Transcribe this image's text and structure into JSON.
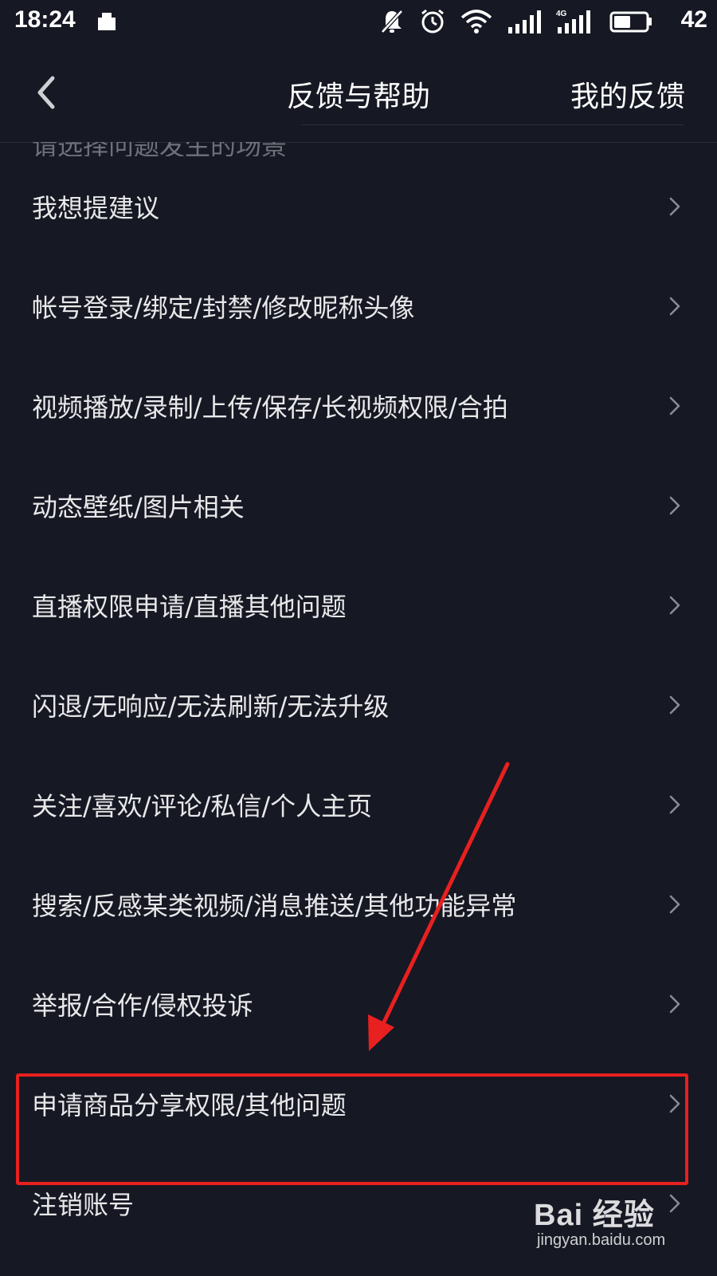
{
  "status_bar": {
    "time": "18:24",
    "network_label": "4G",
    "battery": "42"
  },
  "header": {
    "title": "反馈与帮助",
    "my_feedback": "我的反馈"
  },
  "hint_text": "请选择问题发生的场景",
  "items": [
    {
      "label": "我想提建议"
    },
    {
      "label": "帐号登录/绑定/封禁/修改昵称头像"
    },
    {
      "label": "视频播放/录制/上传/保存/长视频权限/合拍"
    },
    {
      "label": "动态壁纸/图片相关"
    },
    {
      "label": "直播权限申请/直播其他问题"
    },
    {
      "label": "闪退/无响应/无法刷新/无法升级"
    },
    {
      "label": "关注/喜欢/评论/私信/个人主页"
    },
    {
      "label": "搜索/反感某类视频/消息推送/其他功能异常"
    },
    {
      "label": "举报/合作/侵权投诉"
    },
    {
      "label": "申请商品分享权限/其他问题"
    },
    {
      "label": "注销账号"
    }
  ],
  "watermark": {
    "brand": "Bai 经验",
    "url": "jingyan.baidu.com"
  },
  "colors": {
    "background": "#161823",
    "text": "#e8e8ea",
    "chevron": "#8a8c95",
    "annotation": "#e8201f"
  }
}
